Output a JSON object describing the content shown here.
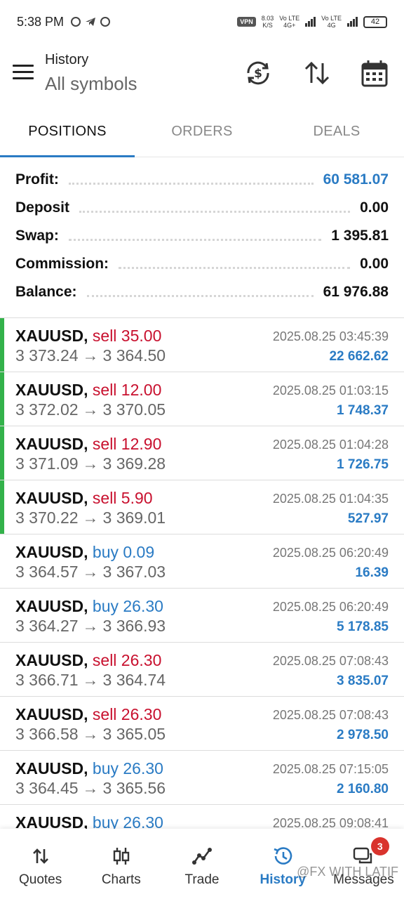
{
  "status_bar": {
    "time": "5:38 PM",
    "speed_value": "8.03",
    "speed_unit": "K/S",
    "vpn": "VPN",
    "net1": "Vo LTE",
    "net1_type": "4G+",
    "net2": "Vo LTE",
    "net2_type": "4G",
    "battery": "42"
  },
  "header": {
    "title": "History",
    "subtitle": "All symbols",
    "icons": [
      "currency-refresh-icon",
      "sort-icon",
      "calendar-icon"
    ]
  },
  "tabs": [
    {
      "label": "POSITIONS",
      "active": true
    },
    {
      "label": "ORDERS",
      "active": false
    },
    {
      "label": "DEALS",
      "active": false
    }
  ],
  "summary": [
    {
      "label": "Profit:",
      "value": "60 581.07",
      "accent": true
    },
    {
      "label": "Deposit",
      "value": "0.00",
      "accent": false
    },
    {
      "label": "Swap:",
      "value": "1 395.81",
      "accent": false
    },
    {
      "label": "Commission:",
      "value": "0.00",
      "accent": false
    },
    {
      "label": "Balance:",
      "value": "61 976.88",
      "accent": false
    }
  ],
  "positions": [
    {
      "symbol": "XAUUSD,",
      "side": "sell",
      "volume": "sell 35.00",
      "open": "3 373.24",
      "close": "3 364.50",
      "time": "2025.08.25 03:45:39",
      "profit": "22 662.62",
      "marked": true
    },
    {
      "symbol": "XAUUSD,",
      "side": "sell",
      "volume": "sell 12.00",
      "open": "3 372.02",
      "close": "3 370.05",
      "time": "2025.08.25 01:03:15",
      "profit": "1 748.37",
      "marked": true
    },
    {
      "symbol": "XAUUSD,",
      "side": "sell",
      "volume": "sell 12.90",
      "open": "3 371.09",
      "close": "3 369.28",
      "time": "2025.08.25 01:04:28",
      "profit": "1 726.75",
      "marked": true
    },
    {
      "symbol": "XAUUSD,",
      "side": "sell",
      "volume": "sell 5.90",
      "open": "3 370.22",
      "close": "3 369.01",
      "time": "2025.08.25 01:04:35",
      "profit": "527.97",
      "marked": true
    },
    {
      "symbol": "XAUUSD,",
      "side": "buy",
      "volume": "buy 0.09",
      "open": "3 364.57",
      "close": "3 367.03",
      "time": "2025.08.25 06:20:49",
      "profit": "16.39",
      "marked": false
    },
    {
      "symbol": "XAUUSD,",
      "side": "buy",
      "volume": "buy 26.30",
      "open": "3 364.27",
      "close": "3 366.93",
      "time": "2025.08.25 06:20:49",
      "profit": "5 178.85",
      "marked": false
    },
    {
      "symbol": "XAUUSD,",
      "side": "sell",
      "volume": "sell 26.30",
      "open": "3 366.71",
      "close": "3 364.74",
      "time": "2025.08.25 07:08:43",
      "profit": "3 835.07",
      "marked": false
    },
    {
      "symbol": "XAUUSD,",
      "side": "sell",
      "volume": "sell 26.30",
      "open": "3 366.58",
      "close": "3 365.05",
      "time": "2025.08.25 07:08:43",
      "profit": "2 978.50",
      "marked": false
    },
    {
      "symbol": "XAUUSD,",
      "side": "buy",
      "volume": "buy 26.30",
      "open": "3 364.45",
      "close": "3 365.56",
      "time": "2025.08.25 07:15:05",
      "profit": "2 160.80",
      "marked": false
    },
    {
      "symbol": "XAUUSD,",
      "side": "buy",
      "volume": "buy 26.30",
      "open": "",
      "close": "",
      "time": "2025.08.25 09:08:41",
      "profit": "",
      "marked": false
    }
  ],
  "arrow": "→",
  "bottom_nav": [
    {
      "label": "Quotes",
      "icon": "quotes-icon",
      "active": false
    },
    {
      "label": "Charts",
      "icon": "charts-icon",
      "active": false
    },
    {
      "label": "Trade",
      "icon": "trade-icon",
      "active": false
    },
    {
      "label": "History",
      "icon": "history-icon",
      "active": true
    },
    {
      "label": "Messages",
      "icon": "messages-icon",
      "active": false,
      "badge": "3"
    }
  ],
  "watermark": "@FX WITH LATIF",
  "colors": {
    "accent": "#2a7bc4",
    "sell": "#c8102e",
    "buy": "#2a7bc4",
    "marker": "#33b24a",
    "badge": "#d9332d"
  }
}
